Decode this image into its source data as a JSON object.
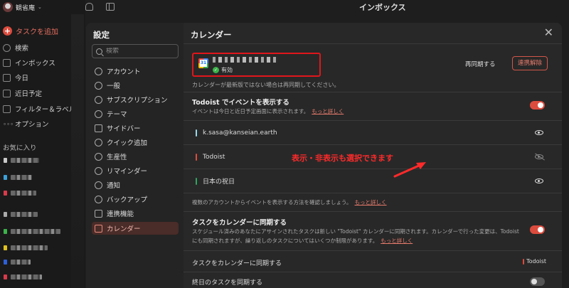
{
  "app": {
    "user_name": "観省庵",
    "page_title": "インボックス",
    "add_task": "タスクを追加",
    "nav": [
      {
        "label": "検索",
        "icon": "search-icon"
      },
      {
        "label": "インボックス",
        "icon": "inbox-icon"
      },
      {
        "label": "今日",
        "icon": "calendar-today-icon"
      },
      {
        "label": "近日予定",
        "icon": "calendar-upcoming-icon"
      },
      {
        "label": "フィルター＆ラベル",
        "icon": "grid-icon"
      },
      {
        "label": "オプション",
        "icon": "more-icon"
      }
    ],
    "favorites_header": "お気に入り"
  },
  "settings": {
    "title": "設定",
    "search_placeholder": "検索",
    "items": [
      {
        "label": "アカウント",
        "icon": "account-icon"
      },
      {
        "label": "一般",
        "icon": "gear-icon"
      },
      {
        "label": "サブスクリプション",
        "icon": "subscription-icon"
      },
      {
        "label": "テーマ",
        "icon": "palette-icon"
      },
      {
        "label": "サイドバー",
        "icon": "sidebar-icon"
      },
      {
        "label": "クイック追加",
        "icon": "quick-add-icon"
      },
      {
        "label": "生産性",
        "icon": "productivity-icon"
      },
      {
        "label": "リマインダー",
        "icon": "clock-icon"
      },
      {
        "label": "通知",
        "icon": "bell-icon"
      },
      {
        "label": "バックアップ",
        "icon": "backup-icon"
      },
      {
        "label": "連携機能",
        "icon": "integrations-icon"
      },
      {
        "label": "カレンダー",
        "icon": "calendar-icon",
        "active": true
      }
    ]
  },
  "calendar": {
    "title": "カレンダー",
    "account_status": "有効",
    "resync_label": "再同期する",
    "disconnect_label": "連携解除",
    "note": "カレンダーが最新版ではない場合は再同期してください。",
    "show_events": {
      "heading": "Todoist でイベントを表示する",
      "sub": "イベントは今日と近日予定画面に表示されます。",
      "link": "もっと詳しく",
      "enabled": true
    },
    "calendars": [
      {
        "name": "k.sasa@kanseian.earth",
        "color": "#9ad8e8",
        "visible": true
      },
      {
        "name": "Todoist",
        "color": "#dc4c3e",
        "visible": false
      },
      {
        "name": "日本の祝日",
        "color": "#2fa561",
        "visible": true
      }
    ],
    "multi_account_note": "複数のアカウントからイベントを表示する方法を確認しましょう。",
    "multi_account_link": "もっと詳しく",
    "sync_tasks": {
      "heading": "タスクをカレンダーに同期する",
      "sub1": "スケジュール済みのあなたにアサインされたタスクは新しい \"Todoist\" カレンダーに同期されます。カレンダーで行った変更は、Todoist",
      "sub2": "にも同期されますが、繰り返しのタスクについてはいくつか制限があります。",
      "link": "もっと詳しく",
      "enabled": true
    },
    "sync_target_label": "タスクをカレンダーに同期する",
    "sync_target_value": "Todoist",
    "all_day_label": "終日のタスクを同期する",
    "all_day_enabled": false
  },
  "annotation": {
    "text": "表示・非表示も選択できます",
    "color": "#ff2a2a"
  },
  "colors": {
    "accent": "#dc4c3e",
    "highlight_box": "#e0161b"
  }
}
